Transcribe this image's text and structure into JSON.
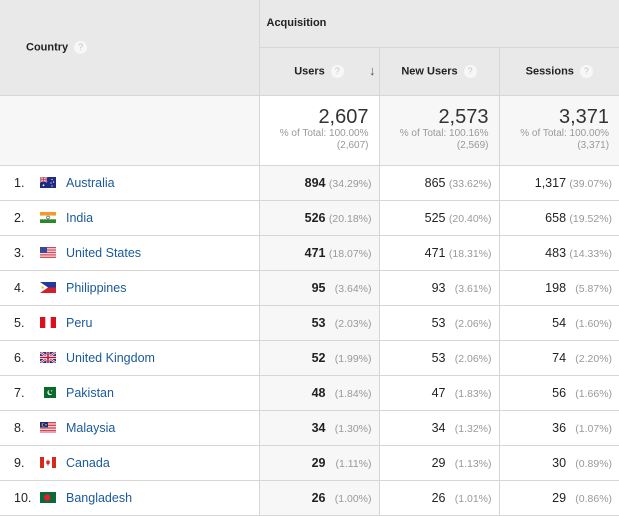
{
  "header": {
    "dimension_label": "Country",
    "group_label": "Acquisition",
    "metrics": [
      {
        "label": "Users",
        "sorted": true
      },
      {
        "label": "New Users",
        "sorted": false
      },
      {
        "label": "Sessions",
        "sorted": false
      }
    ],
    "help_glyph": "?",
    "sort_glyph": "↓"
  },
  "totals": {
    "users": {
      "value": "2,607",
      "pct": "% of Total: 100.00%",
      "abs": "(2,607)"
    },
    "new_users": {
      "value": "2,573",
      "pct": "% of Total: 100.16%",
      "abs": "(2,569)"
    },
    "sessions": {
      "value": "3,371",
      "pct": "% of Total: 100.00%",
      "abs": "(3,371)"
    }
  },
  "rows": [
    {
      "rank": "1.",
      "flag": "australia-flag",
      "country": "Australia",
      "users": "894",
      "users_pct": "(34.29%)",
      "new_users": "865",
      "new_users_pct": "(33.62%)",
      "sessions": "1,317",
      "sessions_pct": "(39.07%)"
    },
    {
      "rank": "2.",
      "flag": "india-flag",
      "country": "India",
      "users": "526",
      "users_pct": "(20.18%)",
      "new_users": "525",
      "new_users_pct": "(20.40%)",
      "sessions": "658",
      "sessions_pct": "(19.52%)"
    },
    {
      "rank": "3.",
      "flag": "united-states-flag",
      "country": "United States",
      "users": "471",
      "users_pct": "(18.07%)",
      "new_users": "471",
      "new_users_pct": "(18.31%)",
      "sessions": "483",
      "sessions_pct": "(14.33%)"
    },
    {
      "rank": "4.",
      "flag": "philippines-flag",
      "country": "Philippines",
      "users": "95",
      "users_pct": "(3.64%)",
      "new_users": "93",
      "new_users_pct": "(3.61%)",
      "sessions": "198",
      "sessions_pct": "(5.87%)"
    },
    {
      "rank": "5.",
      "flag": "peru-flag",
      "country": "Peru",
      "users": "53",
      "users_pct": "(2.03%)",
      "new_users": "53",
      "new_users_pct": "(2.06%)",
      "sessions": "54",
      "sessions_pct": "(1.60%)"
    },
    {
      "rank": "6.",
      "flag": "united-kingdom-flag",
      "country": "United Kingdom",
      "users": "52",
      "users_pct": "(1.99%)",
      "new_users": "53",
      "new_users_pct": "(2.06%)",
      "sessions": "74",
      "sessions_pct": "(2.20%)"
    },
    {
      "rank": "7.",
      "flag": "pakistan-flag",
      "country": "Pakistan",
      "users": "48",
      "users_pct": "(1.84%)",
      "new_users": "47",
      "new_users_pct": "(1.83%)",
      "sessions": "56",
      "sessions_pct": "(1.66%)"
    },
    {
      "rank": "8.",
      "flag": "malaysia-flag",
      "country": "Malaysia",
      "users": "34",
      "users_pct": "(1.30%)",
      "new_users": "34",
      "new_users_pct": "(1.32%)",
      "sessions": "36",
      "sessions_pct": "(1.07%)"
    },
    {
      "rank": "9.",
      "flag": "canada-flag",
      "country": "Canada",
      "users": "29",
      "users_pct": "(1.11%)",
      "new_users": "29",
      "new_users_pct": "(1.13%)",
      "sessions": "30",
      "sessions_pct": "(0.89%)"
    },
    {
      "rank": "10.",
      "flag": "bangladesh-flag",
      "country": "Bangladesh",
      "users": "26",
      "users_pct": "(1.00%)",
      "new_users": "26",
      "new_users_pct": "(1.01%)",
      "sessions": "29",
      "sessions_pct": "(0.86%)"
    }
  ],
  "colors": {
    "link": "#1a5a9a",
    "header_bg": "#e9e9e9",
    "sorted_col_bg": "#f7f7f7",
    "muted_text": "#999999"
  }
}
